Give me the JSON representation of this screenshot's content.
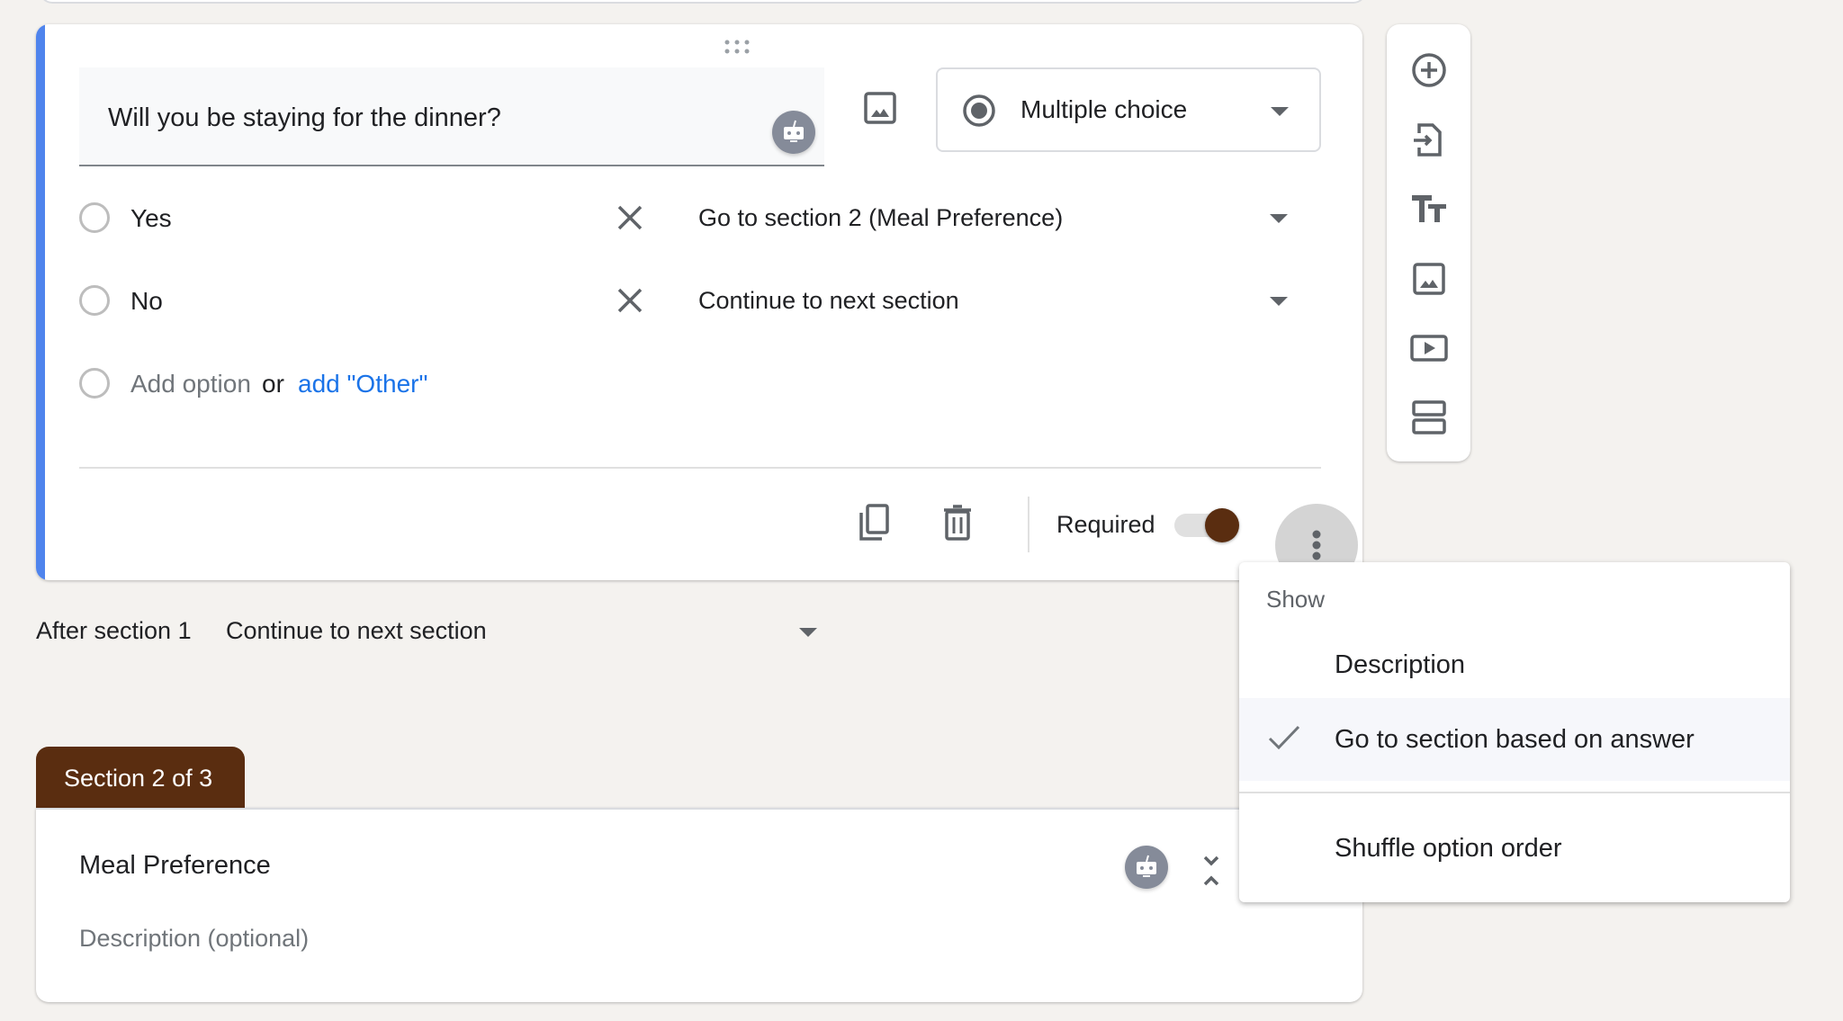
{
  "question": {
    "title": "Will you be staying for the dinner?",
    "type_label": "Multiple choice",
    "options": [
      {
        "label": "Yes",
        "go_to": "Go to section 2 (Meal Preference)"
      },
      {
        "label": "No",
        "go_to": "Continue to next section"
      }
    ],
    "add_option": "Add option",
    "or": "or",
    "add_other": "add \"Other\"",
    "required_label": "Required",
    "required": true
  },
  "after_section": {
    "label": "After section 1",
    "value": "Continue to next section"
  },
  "section2": {
    "tab_label": "Section 2 of 3",
    "title": "Meal Preference",
    "description_placeholder": "Description (optional)"
  },
  "menu": {
    "header": "Show",
    "items": [
      {
        "label": "Description",
        "checked": false
      },
      {
        "label": "Go to section based on answer",
        "checked": true
      },
      {
        "label": "Shuffle option order",
        "checked": false
      }
    ]
  },
  "toolbar": {
    "items": [
      "add-question-icon",
      "import-questions-icon",
      "add-title-icon",
      "add-image-icon",
      "add-video-icon",
      "add-section-icon"
    ]
  },
  "colors": {
    "accent_bar": "#4f84ed",
    "theme": "#5a2d10",
    "link": "#1a73e8",
    "background": "#f4f2ef"
  }
}
